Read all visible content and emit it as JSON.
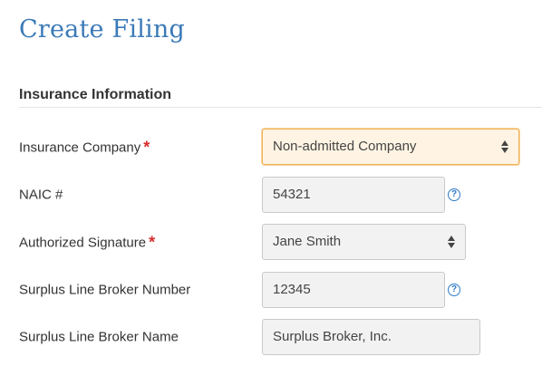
{
  "page": {
    "title": "Create Filing"
  },
  "section": {
    "title": "Insurance Information"
  },
  "fields": {
    "insurance_company": {
      "label": "Insurance Company",
      "required_mark": "*",
      "value": "Non-admitted Company"
    },
    "naic": {
      "label": "NAIC #",
      "value": "54321",
      "help_glyph": "?"
    },
    "authorized_signature": {
      "label": "Authorized Signature",
      "required_mark": "*",
      "value": "Jane Smith"
    },
    "broker_number": {
      "label": "Surplus Line Broker Number",
      "value": "12345",
      "help_glyph": "?"
    },
    "broker_name": {
      "label": "Surplus Line Broker Name",
      "value": "Surplus Broker, Inc."
    }
  },
  "icons": {
    "select_arrows": "select-arrows-icon",
    "help": "help-circle-icon"
  },
  "colors": {
    "title": "#3b7ab8",
    "required": "#d62c2c",
    "help": "#2d77c4",
    "focus_border": "#f0b35c"
  }
}
